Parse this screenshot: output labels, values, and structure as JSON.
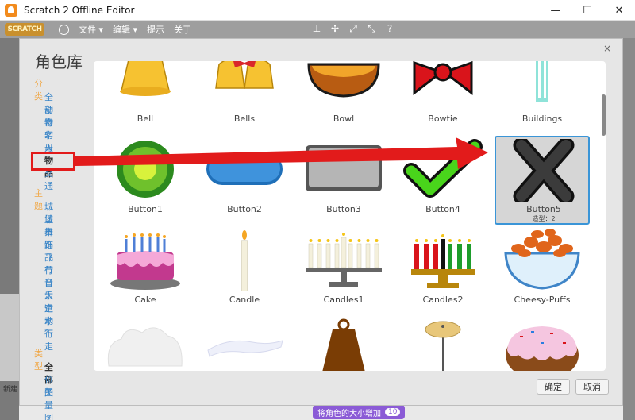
{
  "window": {
    "title": "Scratch 2 Offline Editor",
    "minimize_glyph": "—",
    "maximize_glyph": "☐",
    "close_glyph": "✕"
  },
  "menubar": {
    "logo_text": "SCRATCH",
    "file_label": "文件 ▾",
    "edit_label": "编辑 ▾",
    "tips_label": "提示",
    "about_label": "关于",
    "icons": [
      "stamp-icon",
      "cut-icon",
      "grow-icon",
      "shrink-icon",
      "help-icon"
    ]
  },
  "background": {
    "left_text": "新建",
    "bottom_button_label": "将角色的大小增加",
    "bottom_button_value": "10"
  },
  "dialog": {
    "title": "角色库",
    "close_glyph": "×",
    "ok_label": "确定",
    "cancel_label": "取消",
    "category_heading": "分类",
    "categories": [
      "全部",
      "动物",
      "奇幻",
      "字母",
      "人物",
      "物品",
      "交通"
    ],
    "selected_category": "物品",
    "theme_heading": "主题",
    "themes": [
      "城堡",
      "城市",
      "舞蹈",
      "饰品",
      "飞行",
      "节日",
      "音乐",
      "太空",
      "运动",
      "水下",
      "行走"
    ],
    "type_heading": "类型",
    "types": [
      "全部",
      "位图",
      "矢量图"
    ],
    "selected_type": "全部"
  },
  "sprites": [
    {
      "name": "Bell",
      "icon": "bell-icon"
    },
    {
      "name": "Bells",
      "icon": "bells-icon"
    },
    {
      "name": "Bowl",
      "icon": "bowl-icon"
    },
    {
      "name": "Bowtie",
      "icon": "bowtie-icon"
    },
    {
      "name": "Buildings",
      "icon": "buildings-icon"
    },
    {
      "name": "Button1",
      "icon": "green-button-icon"
    },
    {
      "name": "Button2",
      "icon": "blue-button-icon"
    },
    {
      "name": "Button3",
      "icon": "gray-button-icon"
    },
    {
      "name": "Button4",
      "icon": "checkmark-icon"
    },
    {
      "name": "Button5",
      "icon": "x-mark-icon",
      "costumes": "造型：2",
      "selected": true
    },
    {
      "name": "Cake",
      "icon": "cake-icon"
    },
    {
      "name": "Candle",
      "icon": "candle-icon"
    },
    {
      "name": "Candles1",
      "icon": "menorah-icon"
    },
    {
      "name": "Candles2",
      "icon": "kinara-icon"
    },
    {
      "name": "Cheesy-Puffs",
      "icon": "cheesy-puffs-icon"
    },
    {
      "name": "",
      "icon": "cloud-icon"
    },
    {
      "name": "",
      "icon": "cloth-icon"
    },
    {
      "name": "",
      "icon": "cowbell-icon"
    },
    {
      "name": "",
      "icon": "cymbal-icon"
    },
    {
      "name": "",
      "icon": "donut-icon"
    }
  ],
  "colors": {
    "annotation": "#e21b1b",
    "selection": "#3a95d7",
    "category_link": "#3a85c7",
    "section_heading": "#f0a848"
  }
}
